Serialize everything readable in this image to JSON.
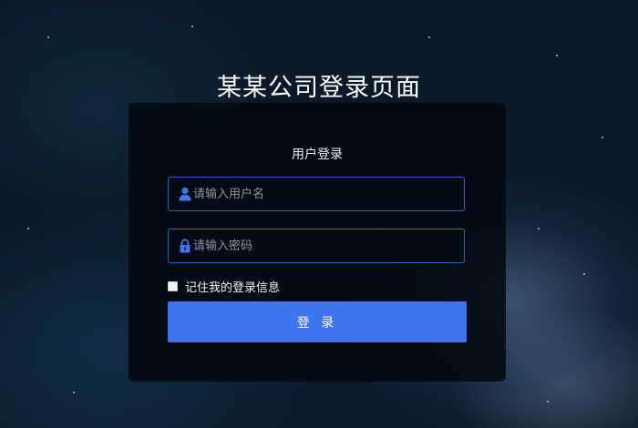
{
  "page": {
    "title": "某某公司登录页面"
  },
  "login_card": {
    "title": "用户登录",
    "username": {
      "placeholder": "请输入用户名",
      "value": "",
      "icon": "user-icon"
    },
    "password": {
      "placeholder": "请输入密码",
      "value": "",
      "icon": "lock-icon"
    },
    "remember": {
      "label": "记住我的登录信息",
      "checked": false
    },
    "submit_label": "登 录"
  },
  "colors": {
    "accent": "#3f75f0",
    "input_border": "#2f62c8",
    "card_background": "#02080f"
  }
}
